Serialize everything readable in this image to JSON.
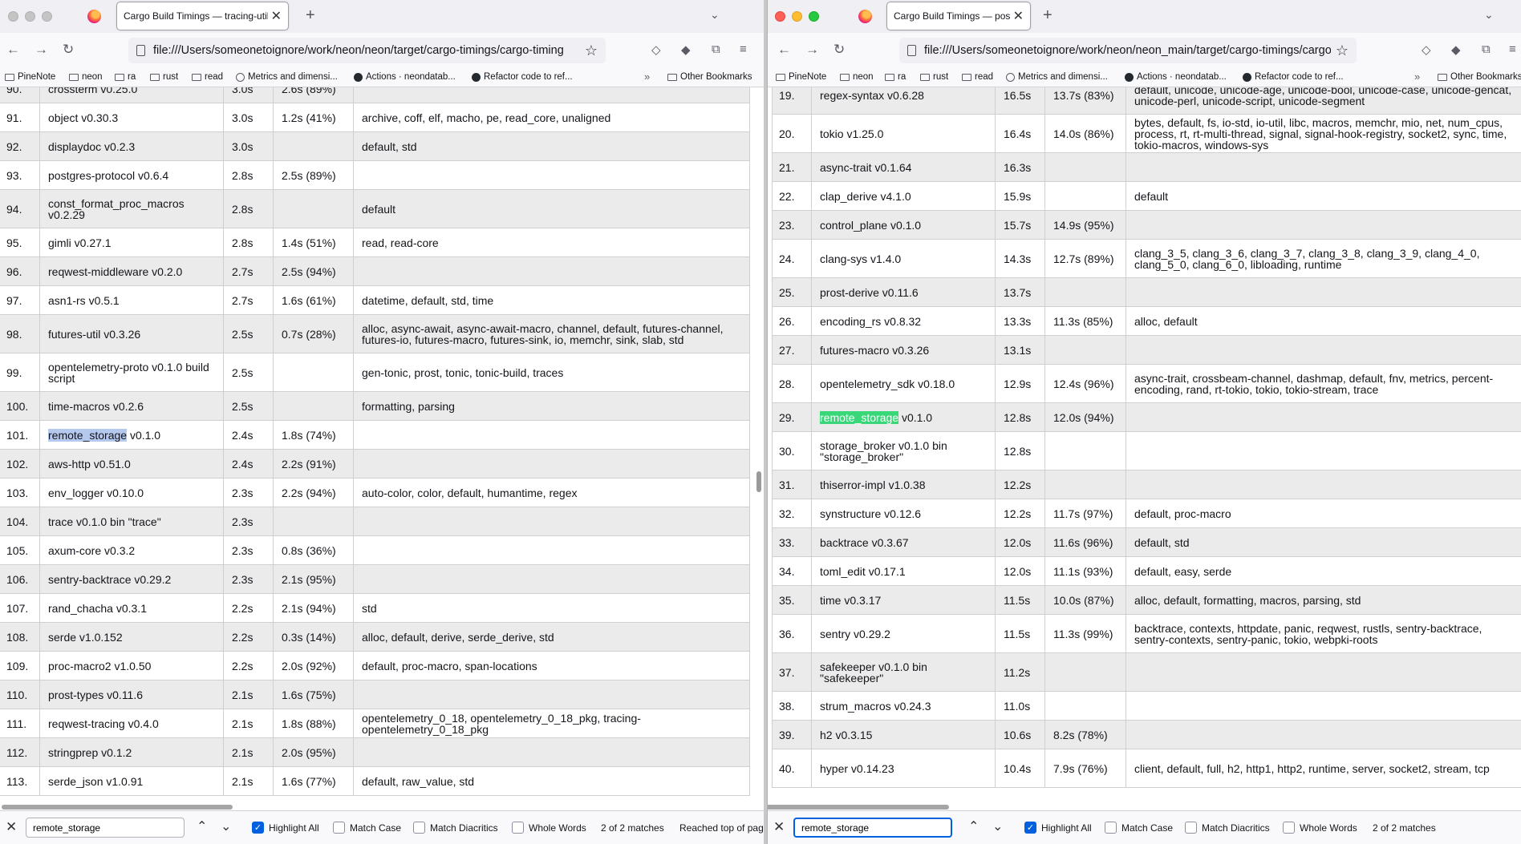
{
  "left": {
    "tab_title": "Cargo Build Timings — tracing-utils",
    "url": "file:///Users/someonetoignore/work/neon/neon/target/cargo-timings/cargo-timing",
    "bookmarks": [
      "PineNote",
      "neon",
      "ra",
      "rust",
      "read",
      "Metrics and dimensi...",
      "Actions · neondatab...",
      "Refactor code to ref..."
    ],
    "other_bookmarks": "Other Bookmarks",
    "rows": [
      {
        "n": "90.",
        "name": "crossterm v0.25.0",
        "total": "3.0s",
        "codegen": "2.6s (89%)",
        "features": ""
      },
      {
        "n": "91.",
        "name": "object v0.30.3",
        "total": "3.0s",
        "codegen": "1.2s (41%)",
        "features": "archive, coff, elf, macho, pe, read_core, unaligned"
      },
      {
        "n": "92.",
        "name": "displaydoc v0.2.3",
        "total": "3.0s",
        "codegen": "",
        "features": "default, std"
      },
      {
        "n": "93.",
        "name": "postgres-protocol v0.6.4",
        "total": "2.8s",
        "codegen": "2.5s (89%)",
        "features": ""
      },
      {
        "n": "94.",
        "name": "const_format_proc_macros v0.2.29",
        "total": "2.8s",
        "codegen": "",
        "features": "default"
      },
      {
        "n": "95.",
        "name": "gimli v0.27.1",
        "total": "2.8s",
        "codegen": "1.4s (51%)",
        "features": "read, read-core"
      },
      {
        "n": "96.",
        "name": "reqwest-middleware v0.2.0",
        "total": "2.7s",
        "codegen": "2.5s (94%)",
        "features": ""
      },
      {
        "n": "97.",
        "name": "asn1-rs v0.5.1",
        "total": "2.7s",
        "codegen": "1.6s (61%)",
        "features": "datetime, default, std, time"
      },
      {
        "n": "98.",
        "name": "futures-util v0.3.26",
        "total": "2.5s",
        "codegen": "0.7s (28%)",
        "features": "alloc, async-await, async-await-macro, channel, default, futures-channel, futures-io, futures-macro, futures-sink, io, memchr, sink, slab, std"
      },
      {
        "n": "99.",
        "name": "opentelemetry-proto v0.1.0 build script",
        "total": "2.5s",
        "codegen": "",
        "features": "gen-tonic, prost, tonic, tonic-build, traces"
      },
      {
        "n": "100.",
        "name": "time-macros v0.2.6",
        "total": "2.5s",
        "codegen": "",
        "features": "formatting, parsing"
      },
      {
        "n": "101.",
        "name_hl": "remote_storage",
        "name_rest": " v0.1.0",
        "total": "2.4s",
        "codegen": "1.8s (74%)",
        "features": ""
      },
      {
        "n": "102.",
        "name": "aws-http v0.51.0",
        "total": "2.4s",
        "codegen": "2.2s (91%)",
        "features": ""
      },
      {
        "n": "103.",
        "name": "env_logger v0.10.0",
        "total": "2.3s",
        "codegen": "2.2s (94%)",
        "features": "auto-color, color, default, humantime, regex"
      },
      {
        "n": "104.",
        "name": "trace v0.1.0 bin \"trace\"",
        "total": "2.3s",
        "codegen": "",
        "features": ""
      },
      {
        "n": "105.",
        "name": "axum-core v0.3.2",
        "total": "2.3s",
        "codegen": "0.8s (36%)",
        "features": ""
      },
      {
        "n": "106.",
        "name": "sentry-backtrace v0.29.2",
        "total": "2.3s",
        "codegen": "2.1s (95%)",
        "features": ""
      },
      {
        "n": "107.",
        "name": "rand_chacha v0.3.1",
        "total": "2.2s",
        "codegen": "2.1s (94%)",
        "features": "std"
      },
      {
        "n": "108.",
        "name": "serde v1.0.152",
        "total": "2.2s",
        "codegen": "0.3s (14%)",
        "features": "alloc, default, derive, serde_derive, std"
      },
      {
        "n": "109.",
        "name": "proc-macro2 v1.0.50",
        "total": "2.2s",
        "codegen": "2.0s (92%)",
        "features": "default, proc-macro, span-locations"
      },
      {
        "n": "110.",
        "name": "prost-types v0.11.6",
        "total": "2.1s",
        "codegen": "1.6s (75%)",
        "features": ""
      },
      {
        "n": "111.",
        "name": "reqwest-tracing v0.4.0",
        "total": "2.1s",
        "codegen": "1.8s (88%)",
        "features": "opentelemetry_0_18, opentelemetry_0_18_pkg, tracing-opentelemetry_0_18_pkg"
      },
      {
        "n": "112.",
        "name": "stringprep v0.1.2",
        "total": "2.1s",
        "codegen": "2.0s (95%)",
        "features": ""
      },
      {
        "n": "113.",
        "name": "serde_json v1.0.91",
        "total": "2.1s",
        "codegen": "1.6s (77%)",
        "features": "default, raw_value, std"
      }
    ],
    "find": {
      "value": "remote_storage",
      "highlight_all": "Highlight All",
      "match_case": "Match Case",
      "match_diacritics": "Match Diacritics",
      "whole_words": "Whole Words",
      "matches": "2 of 2 matches",
      "status": "Reached top of page"
    }
  },
  "right": {
    "tab_title": "Cargo Build Timings — postgres_ffi",
    "url": "file:///Users/someonetoignore/work/neon/neon_main/target/cargo-timings/cargo-",
    "bookmarks": [
      "PineNote",
      "neon",
      "ra",
      "rust",
      "read",
      "Metrics and dimensi...",
      "Actions · neondatab...",
      "Refactor code to ref..."
    ],
    "other_bookmarks": "Other Bookmarks",
    "rows": [
      {
        "n": "19.",
        "name": "regex-syntax v0.6.28",
        "total": "16.5s",
        "codegen": "13.7s (83%)",
        "features": "default, unicode, unicode-age, unicode-bool, unicode-case, unicode-gencat, unicode-perl, unicode-script, unicode-segment"
      },
      {
        "n": "20.",
        "name": "tokio v1.25.0",
        "total": "16.4s",
        "codegen": "14.0s (86%)",
        "features": "bytes, default, fs, io-std, io-util, libc, macros, memchr, mio, net, num_cpus, process, rt, rt-multi-thread, signal, signal-hook-registry, socket2, sync, time, tokio-macros, windows-sys"
      },
      {
        "n": "21.",
        "name": "async-trait v0.1.64",
        "total": "16.3s",
        "codegen": "",
        "features": ""
      },
      {
        "n": "22.",
        "name": "clap_derive v4.1.0",
        "total": "15.9s",
        "codegen": "",
        "features": "default"
      },
      {
        "n": "23.",
        "name": "control_plane v0.1.0",
        "total": "15.7s",
        "codegen": "14.9s (95%)",
        "features": ""
      },
      {
        "n": "24.",
        "name": "clang-sys v1.4.0",
        "total": "14.3s",
        "codegen": "12.7s (89%)",
        "features": "clang_3_5, clang_3_6, clang_3_7, clang_3_8, clang_3_9, clang_4_0, clang_5_0, clang_6_0, libloading, runtime"
      },
      {
        "n": "25.",
        "name": "prost-derive v0.11.6",
        "total": "13.7s",
        "codegen": "",
        "features": ""
      },
      {
        "n": "26.",
        "name": "encoding_rs v0.8.32",
        "total": "13.3s",
        "codegen": "11.3s (85%)",
        "features": "alloc, default"
      },
      {
        "n": "27.",
        "name": "futures-macro v0.3.26",
        "total": "13.1s",
        "codegen": "",
        "features": ""
      },
      {
        "n": "28.",
        "name": "opentelemetry_sdk v0.18.0",
        "total": "12.9s",
        "codegen": "12.4s (96%)",
        "features": "async-trait, crossbeam-channel, dashmap, default, fnv, metrics, percent-encoding, rand, rt-tokio, tokio, tokio-stream, trace"
      },
      {
        "n": "29.",
        "name_hl": "remote_storage",
        "name_rest": " v0.1.0",
        "total": "12.8s",
        "codegen": "12.0s (94%)",
        "features": ""
      },
      {
        "n": "30.",
        "name": "storage_broker v0.1.0 bin \"storage_broker\"",
        "total": "12.8s",
        "codegen": "",
        "features": ""
      },
      {
        "n": "31.",
        "name": "thiserror-impl v1.0.38",
        "total": "12.2s",
        "codegen": "",
        "features": ""
      },
      {
        "n": "32.",
        "name": "synstructure v0.12.6",
        "total": "12.2s",
        "codegen": "11.7s (97%)",
        "features": "default, proc-macro"
      },
      {
        "n": "33.",
        "name": "backtrace v0.3.67",
        "total": "12.0s",
        "codegen": "11.6s (96%)",
        "features": "default, std"
      },
      {
        "n": "34.",
        "name": "toml_edit v0.17.1",
        "total": "12.0s",
        "codegen": "11.1s (93%)",
        "features": "default, easy, serde"
      },
      {
        "n": "35.",
        "name": "time v0.3.17",
        "total": "11.5s",
        "codegen": "10.0s (87%)",
        "features": "alloc, default, formatting, macros, parsing, std"
      },
      {
        "n": "36.",
        "name": "sentry v0.29.2",
        "total": "11.5s",
        "codegen": "11.3s (99%)",
        "features": "backtrace, contexts, httpdate, panic, reqwest, rustls, sentry-backtrace, sentry-contexts, sentry-panic, tokio, webpki-roots"
      },
      {
        "n": "37.",
        "name": "safekeeper v0.1.0 bin \"safekeeper\"",
        "total": "11.2s",
        "codegen": "",
        "features": ""
      },
      {
        "n": "38.",
        "name": "strum_macros v0.24.3",
        "total": "11.0s",
        "codegen": "",
        "features": ""
      },
      {
        "n": "39.",
        "name": "h2 v0.3.15",
        "total": "10.6s",
        "codegen": "8.2s (78%)",
        "features": ""
      },
      {
        "n": "40.",
        "name": "hyper v0.14.23",
        "total": "10.4s",
        "codegen": "7.9s (76%)",
        "features": "client, default, full, h2, http1, http2, runtime, server, socket2, stream, tcp"
      }
    ],
    "find": {
      "value": "remote_storage",
      "highlight_all": "Highlight All",
      "match_case": "Match Case",
      "match_diacritics": "Match Diacritics",
      "whole_words": "Whole Words",
      "matches": "2 of 2 matches"
    }
  }
}
